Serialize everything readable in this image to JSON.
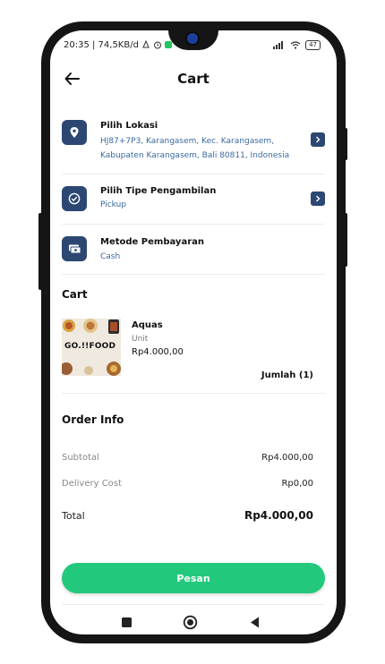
{
  "status_bar": {
    "left_text": "20:35 | 74,5KB/d",
    "battery": "47"
  },
  "header": {
    "title": "Cart"
  },
  "location": {
    "title": "Pilih Lokasi",
    "address_line1": "HJ87+7P3, Karangasem, Kec. Karangasem,",
    "address_line2": "Kabupaten Karangasem, Bali 80811, Indonesia"
  },
  "pickup": {
    "title": "Pilih Tipe Pengambilan",
    "value": "Pickup"
  },
  "payment": {
    "title": "Metode Pembayaran",
    "value": "Cash"
  },
  "cart": {
    "section_title": "Cart",
    "item": {
      "name": "Aquas",
      "unit": "Unit",
      "price": "Rp4.000,00",
      "quantity": "Jumlah (1)",
      "image_logo_text": "GO.!!FOOD"
    }
  },
  "order_info": {
    "title": "Order Info",
    "subtotal_label": "Subtotal",
    "subtotal_value": "Rp4.000,00",
    "delivery_label": "Delivery Cost",
    "delivery_value": "Rp0,00",
    "total_label": "Total",
    "total_value": "Rp4.000,00"
  },
  "actions": {
    "submit_label": "Pesan"
  },
  "colors": {
    "accent_green": "#22c97c",
    "icon_navy": "#2d4773",
    "link_blue": "#3b6aa0"
  }
}
